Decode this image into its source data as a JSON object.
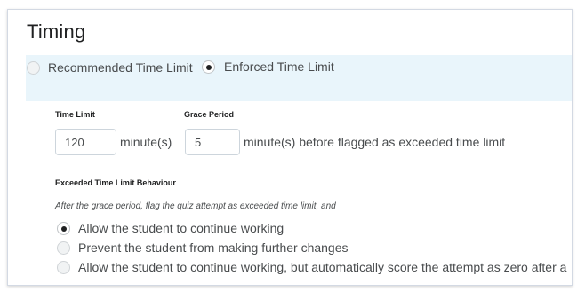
{
  "section": {
    "title": "Timing"
  },
  "mode": {
    "options": [
      {
        "label": "Recommended Time Limit",
        "checked": false
      },
      {
        "label": "Enforced Time Limit",
        "checked": true
      }
    ]
  },
  "limits": {
    "time_limit_label": "Time Limit",
    "time_limit_value": "120",
    "time_limit_unit": "minute(s)",
    "grace_period_label": "Grace Period",
    "grace_period_value": "5",
    "grace_period_unit": "minute(s) before flagged as exceeded time limit"
  },
  "behaviour": {
    "heading": "Exceeded Time Limit Behaviour",
    "description": "After the grace period, flag the quiz attempt as exceeded time limit, and",
    "options": [
      {
        "label": "Allow the student to continue working",
        "checked": true
      },
      {
        "label": "Prevent the student from making further changes",
        "checked": false
      },
      {
        "label": "Allow the student to continue working, but automatically score the attempt as zero after a",
        "checked": false
      }
    ]
  }
}
